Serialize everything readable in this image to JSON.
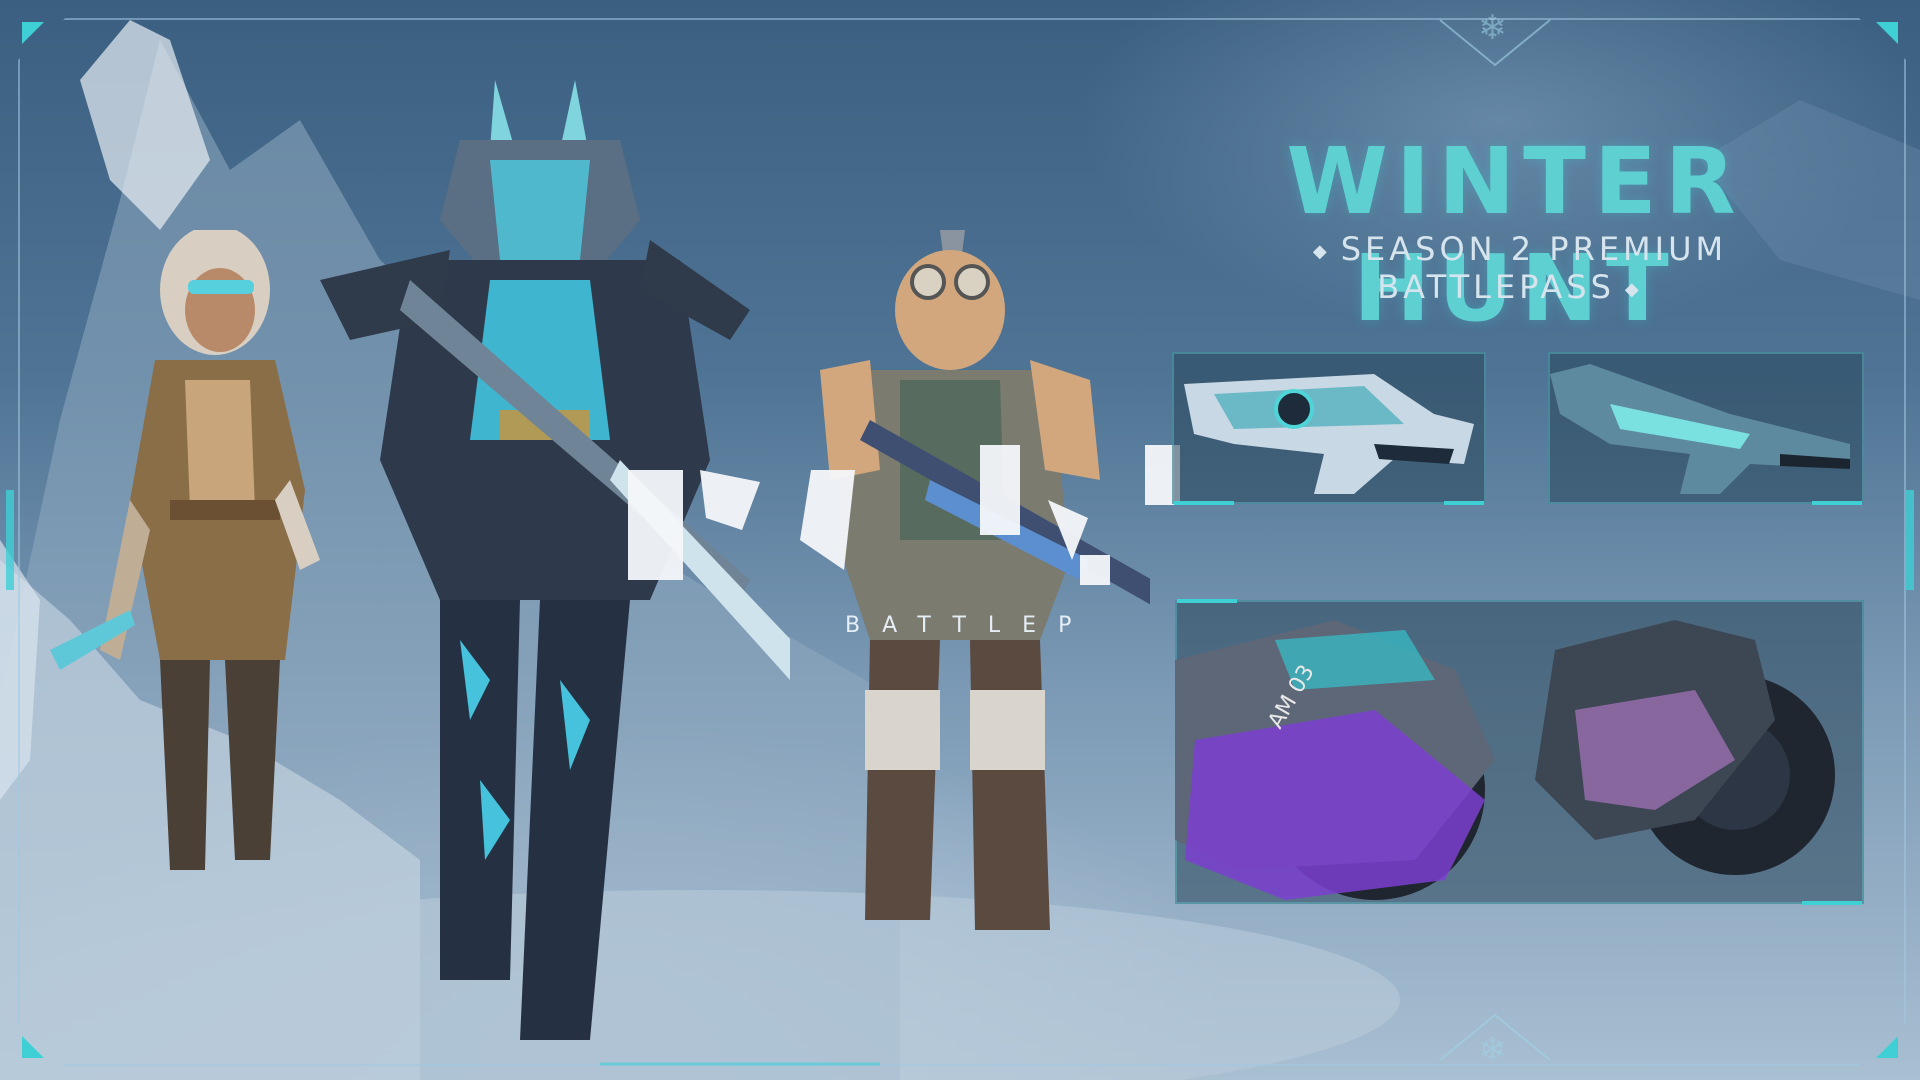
{
  "title": "WINTER HUNT",
  "subtitle": "SEASON 2 PREMIUM BATTLEPASS",
  "overlay_fragment": "BATTLEP",
  "bike_plate": "AM 03",
  "icons": {
    "top_emblem": "snowflake-icon",
    "bottom_emblem": "snowflake-icon"
  },
  "colors": {
    "accent": "#5fd0d1",
    "frame": "#47d3d9",
    "subtitle": "#d6e4ee",
    "bike_purple": "#7b3fd0"
  },
  "characters": [
    {
      "name": "hooded-huntress"
    },
    {
      "name": "lion-beast-warrior"
    },
    {
      "name": "goggled-brute"
    }
  ],
  "rewards": [
    {
      "kind": "weapon-skin-1"
    },
    {
      "kind": "weapon-skin-2"
    },
    {
      "kind": "motorbike-skin"
    }
  ]
}
